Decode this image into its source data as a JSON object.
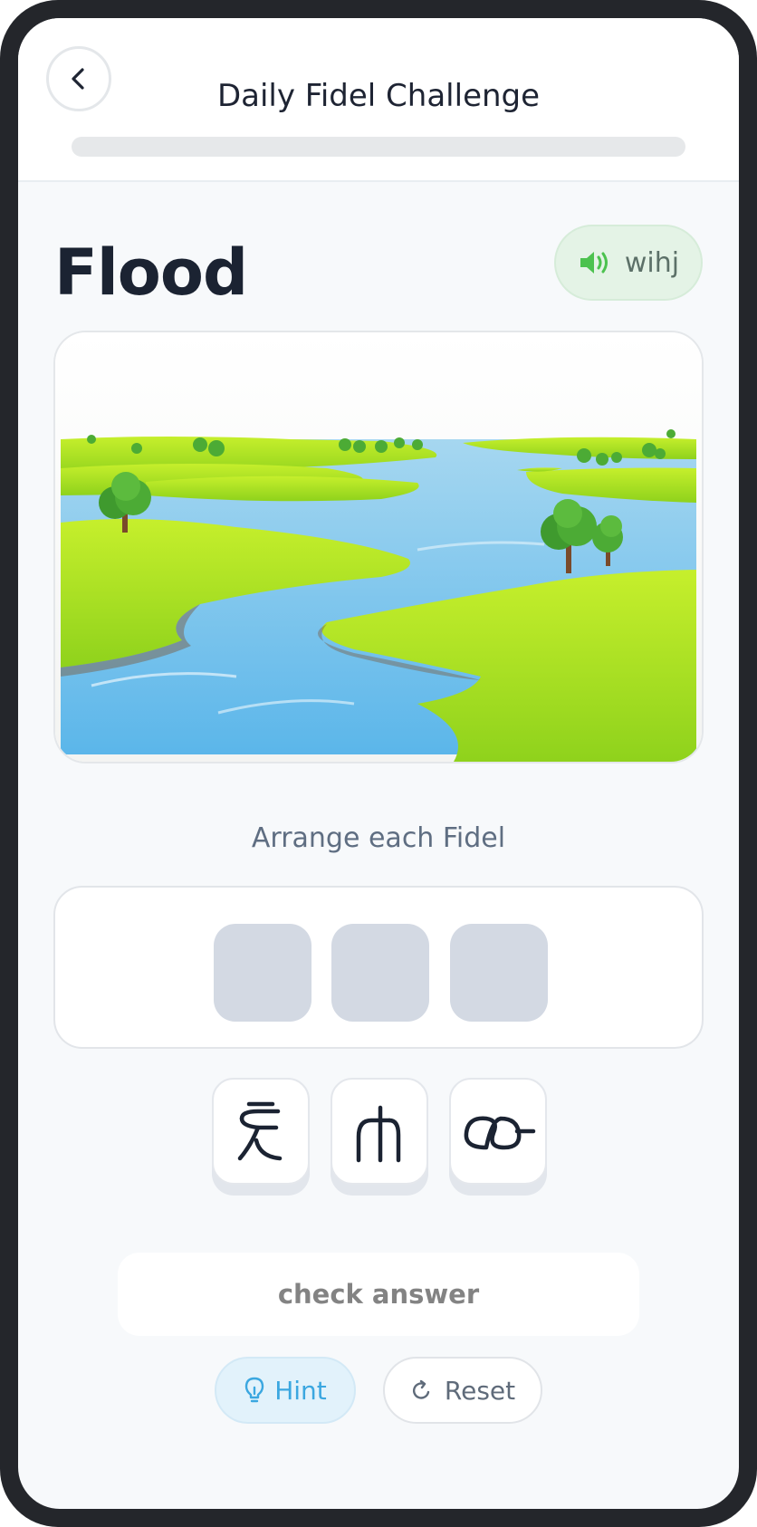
{
  "header": {
    "title": "Daily Fidel Challenge",
    "progress": 0
  },
  "word": {
    "english": "Flood",
    "audio_label": "wihj"
  },
  "image": {
    "subject": "flood-landscape-illustration"
  },
  "instruction": "Arrange each Fidel",
  "answer_slots": [
    "",
    "",
    ""
  ],
  "letter_tiles": [
    {
      "glyph": "ጀ"
    },
    {
      "glyph": "ሐ"
    },
    {
      "glyph": "ው"
    }
  ],
  "actions": {
    "check_label": "check answer",
    "hint_label": "Hint",
    "reset_label": "Reset"
  },
  "colors": {
    "audio_accent": "#4cc24f",
    "hint_accent": "#3ba7e0",
    "text_dark": "#1b2332"
  },
  "icons": {
    "back": "chevron-left-icon",
    "audio": "speaker-icon",
    "hint": "lightbulb-icon",
    "reset": "refresh-icon"
  }
}
